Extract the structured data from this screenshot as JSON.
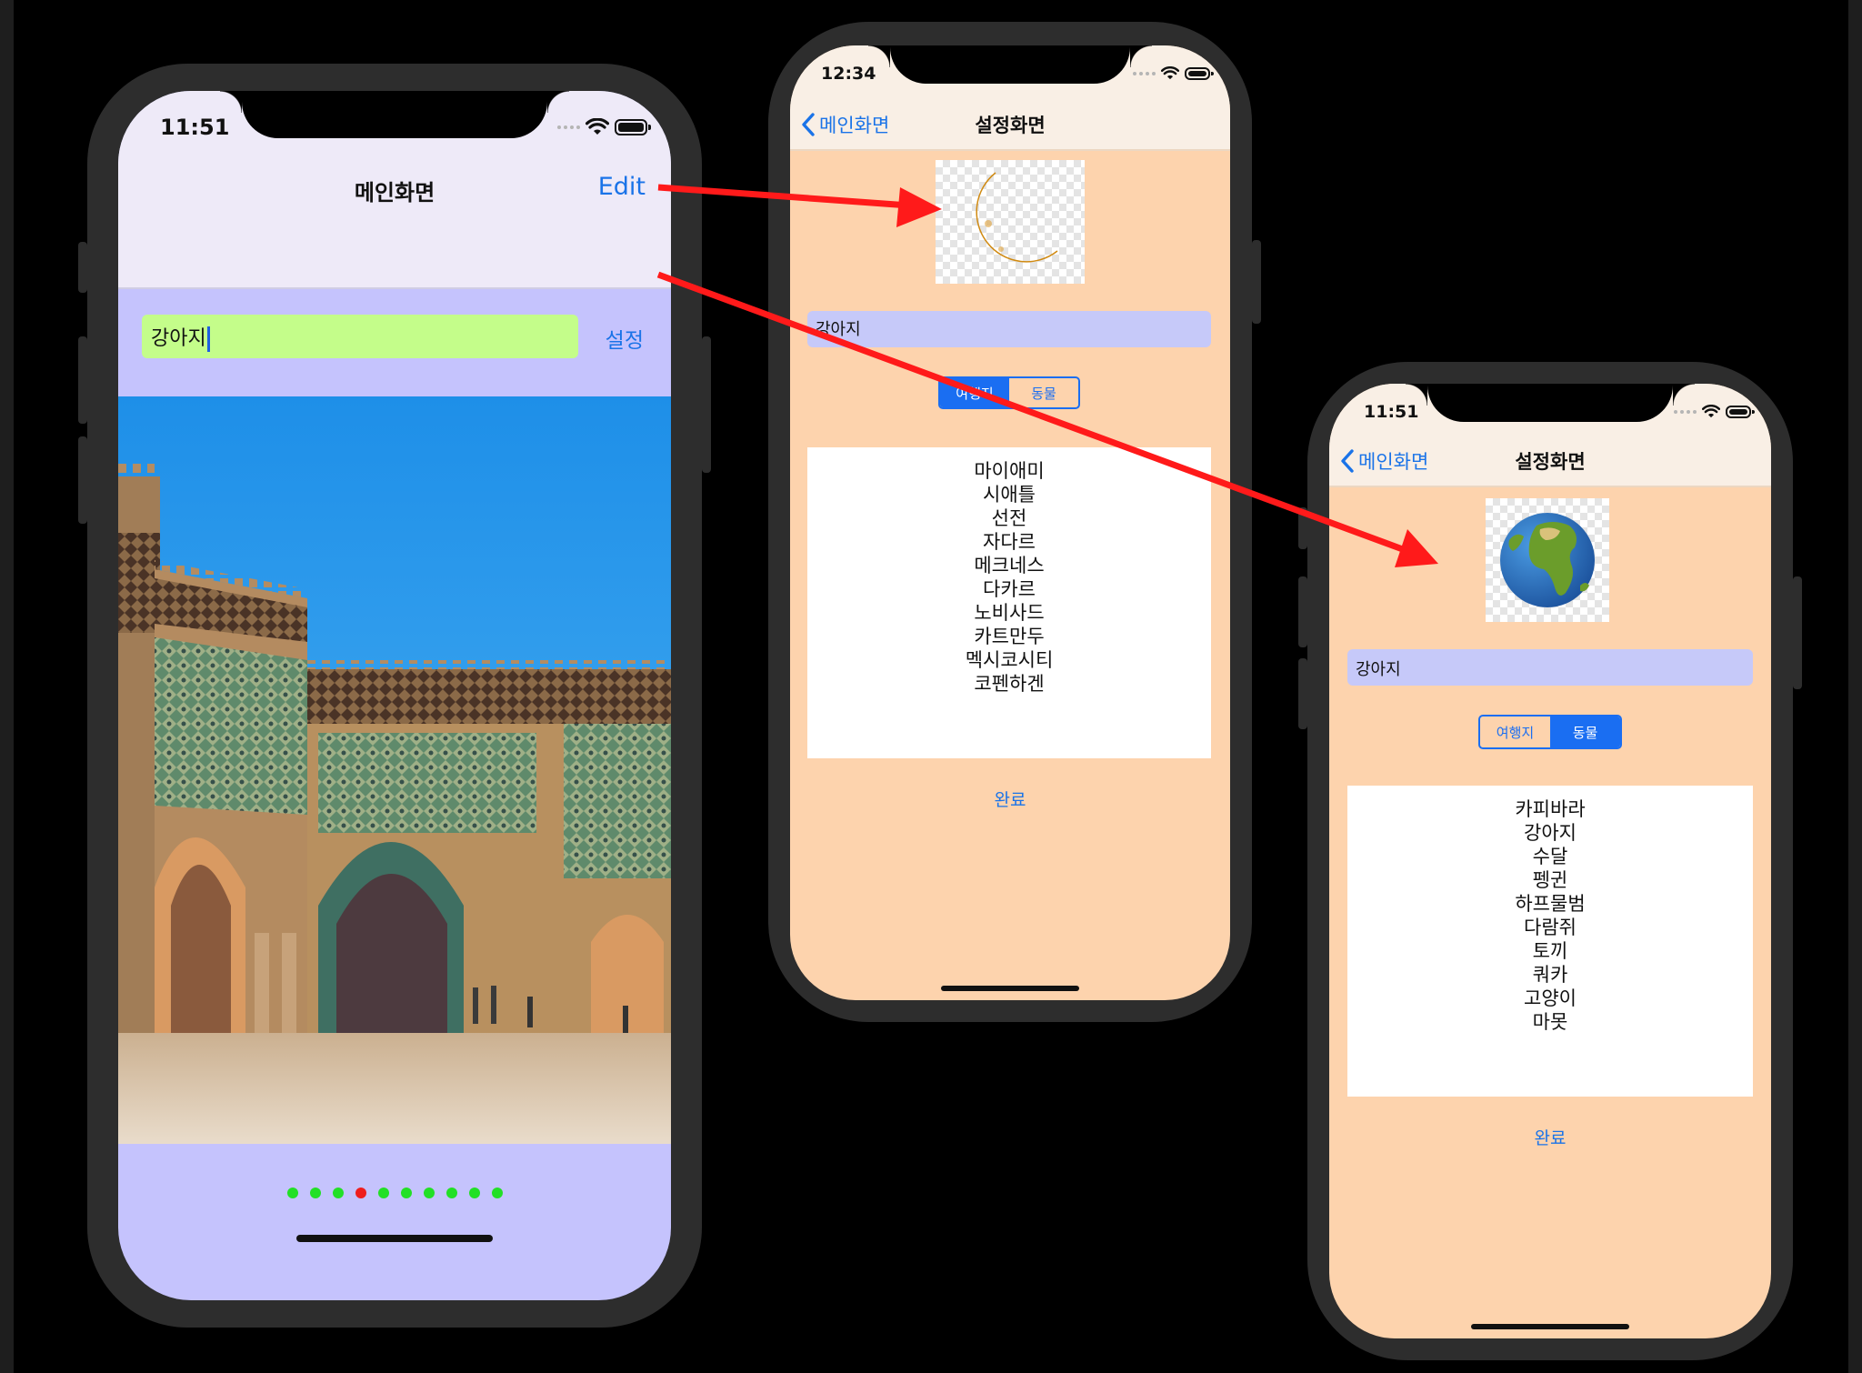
{
  "main_screen": {
    "status_time": "11:51",
    "nav_title": "메인화면",
    "edit_label": "Edit",
    "text_field_value": "강아지",
    "settings_button_label": "설정",
    "page_control": {
      "count": 10,
      "current_index": 3,
      "dot_color": "#22e026",
      "current_dot_color": "#ef1d1d"
    },
    "background_color": "#c5c3fd",
    "text_field_color": "#c4fd8a"
  },
  "settings_screen_travel": {
    "status_time": "12:34",
    "back_label": "메인화면",
    "nav_title": "설정화면",
    "image_icon": "crescent-moon",
    "text_field_value": "강아지",
    "segments": [
      "여행지",
      "동물"
    ],
    "selected_segment": 0,
    "picker_items": [
      "마이애미",
      "시애틀",
      "선전",
      "자다르",
      "메크네스",
      "다카르",
      "노비사드",
      "카트만두",
      "멕시코시티",
      "코펜하겐"
    ],
    "done_label": "완료",
    "background_color": "#fdd3ad"
  },
  "settings_screen_animals": {
    "status_time": "11:51",
    "back_label": "메인화면",
    "nav_title": "설정화면",
    "image_icon": "globe-earth",
    "text_field_value": "강아지",
    "segments": [
      "여행지",
      "동물"
    ],
    "selected_segment": 1,
    "picker_items": [
      "카피바라",
      "강아지",
      "수달",
      "펭귄",
      "하프물범",
      "다람쥐",
      "토끼",
      "쿼카",
      "고양이",
      "마못"
    ],
    "done_label": "완료",
    "background_color": "#fdd3ad"
  },
  "annotations": {
    "arrow_color": "#ff1a1a"
  }
}
